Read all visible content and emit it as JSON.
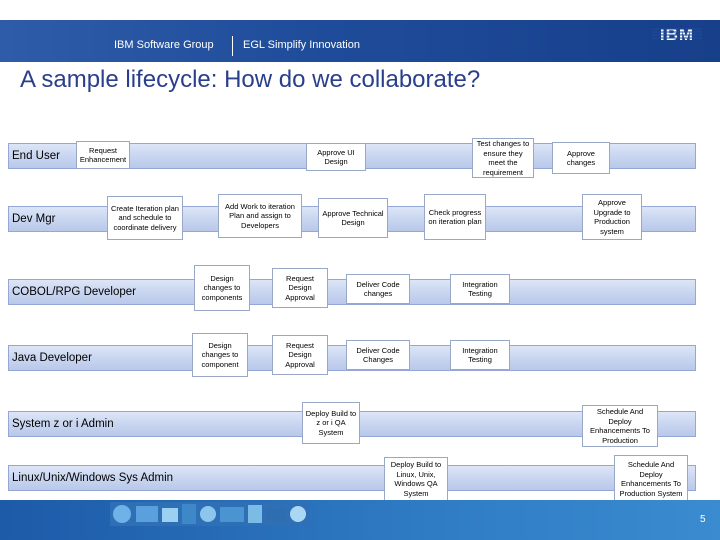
{
  "header": {
    "group": "IBM Software Group",
    "tagline": "EGL Simplify Innovation",
    "logo_text": "IBM"
  },
  "slide": {
    "title": "A sample lifecycle:  How do we collaborate?",
    "page_number": "5"
  },
  "roles": {
    "end_user": "End User",
    "dev_mgr": "Dev Mgr",
    "cobol_dev": "COBOL/RPG Developer",
    "java_dev": "Java Developer",
    "sysz_admin": "System z or i Admin",
    "luw_admin": "Linux/Unix/Windows Sys Admin"
  },
  "tasks": {
    "request_enhancement": "Request Enhancement",
    "approve_ui_design": "Approve UI Design",
    "test_changes": "Test changes to ensure they meet the requirement",
    "approve_changes": "Approve changes",
    "create_iteration_plan": "Create Iteration plan and schedule to coordinate delivery",
    "add_work": "Add Work to iteration Plan and assign to Developers",
    "approve_tech_design": "Approve Technical Design",
    "check_progress": "Check progress on iteration plan",
    "approve_upgrade": "Approve Upgrade to Production system",
    "cobol_design_changes": "Design changes to components",
    "cobol_request_approval": "Request Design Approval",
    "cobol_deliver": "Deliver Code changes",
    "cobol_integration": "Integration Testing",
    "java_design_changes": "Design changes to component",
    "java_request_approval": "Request Design Approval",
    "java_deliver": "Deliver Code Changes",
    "java_integration": "Integration Testing",
    "deploy_sysz": "Deploy Build to z or i QA System",
    "schedule_sysz": "Schedule And Deploy Enhancements To Production",
    "deploy_luw": "Deploy Build to Linux, Unix, Windows QA System",
    "schedule_luw": "Schedule And Deploy Enhancements To Production System"
  },
  "colors": {
    "header_blue": "#1f4c9a",
    "title_blue": "#2a3f8c",
    "lane_fill": "#c9d6f0"
  }
}
